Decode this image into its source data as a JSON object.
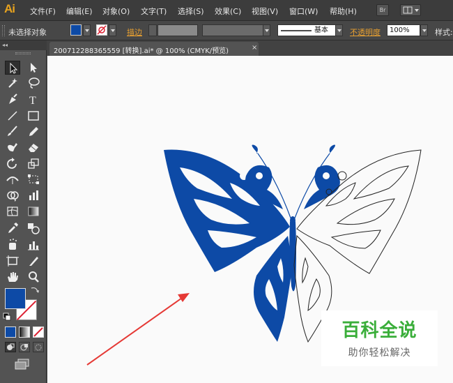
{
  "app": {
    "logo": "Ai",
    "bridge_label": "Br"
  },
  "menu": [
    "文件(F)",
    "编辑(E)",
    "对象(O)",
    "文字(T)",
    "选择(S)",
    "效果(C)",
    "视图(V)",
    "窗口(W)",
    "帮助(H)"
  ],
  "control": {
    "selection_status": "未选择对象",
    "stroke_label": "描边",
    "stroke_profile": "基本",
    "opacity_label": "不透明度",
    "opacity_value": "100%",
    "style_label": "样式"
  },
  "toolbox": {
    "collapse_label": "◂◂"
  },
  "document": {
    "tab_title": "200712288365559 [转换].ai* @ 100% (CMYK/预览)",
    "close_glyph": "×"
  },
  "colors": {
    "fill": "#0d4aa6",
    "stroke": "#ffffff",
    "accent": "#e8a31e",
    "arrow": "#e53935"
  },
  "watermark": {
    "title": "百科全说",
    "subtitle": "助你轻松解决"
  }
}
